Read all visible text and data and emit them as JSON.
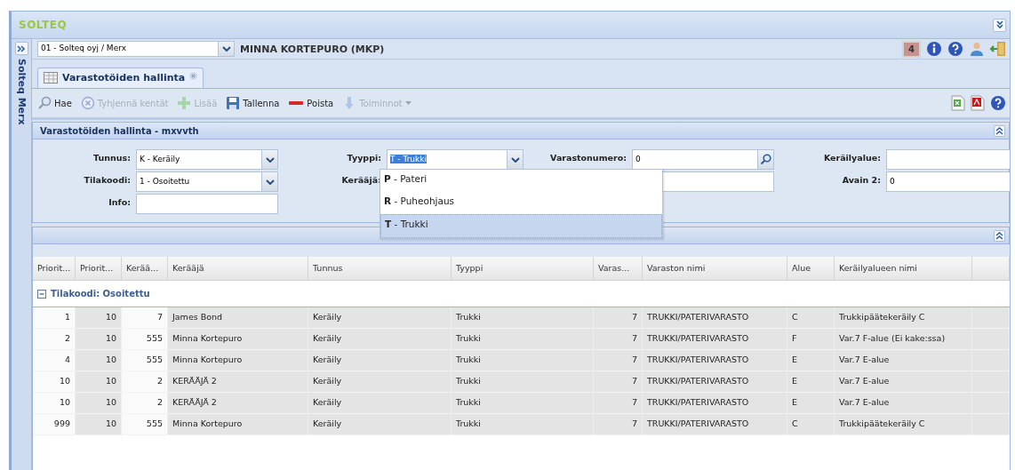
{
  "app": {
    "logo": "SOLTEQ"
  },
  "sidebar": {
    "title": "Solteq Merx",
    "expanded": false
  },
  "topbar": {
    "company": "01 - Solteq oyj / Merx",
    "user": "MINNA KORTEPURO (MKP)",
    "badge": "4"
  },
  "tabs": [
    {
      "label": "Varastotöiden hallinta",
      "selected": true
    }
  ],
  "toolbar": [
    {
      "kind": "search",
      "label": "Hae",
      "disabled": false
    },
    {
      "kind": "clear",
      "label": "Tyhjennä kentät",
      "disabled": true
    },
    {
      "kind": "add",
      "label": "Lisää",
      "disabled": true
    },
    {
      "kind": "save",
      "label": "Tallenna",
      "disabled": false
    },
    {
      "kind": "delete",
      "label": "Poista",
      "disabled": false
    },
    {
      "kind": "actions",
      "label": "Toiminnot",
      "disabled": true
    }
  ],
  "form": {
    "title": "Varastotöiden hallinta - mxvvth",
    "expanded": true,
    "fields": [
      {
        "kind": "combo",
        "label": "Tunnus:",
        "value": "K - Keräily"
      },
      {
        "kind": "combo",
        "label": "Tyyppi:",
        "value": "T - Trukki",
        "highlighted": true
      },
      {
        "kind": "search",
        "label": "Varastonumero:",
        "value": "0"
      },
      {
        "kind": "text",
        "label": "Keräilyalue:"
      },
      {
        "kind": "combo",
        "label": "Tilakoodi:",
        "value": "1 - Osoitettu"
      },
      {
        "kind": "wide",
        "label": "Kerääjä:"
      },
      {
        "kind": "text",
        "label": "Avain 2:",
        "value": "0"
      },
      {
        "kind": "text",
        "label": "Info:"
      }
    ]
  },
  "dropdown": {
    "options": [
      {
        "label": "**P** - Pateri",
        "selected": false
      },
      {
        "label": "**R** - Puheohjaus",
        "selected": false
      },
      {
        "label": "**T** - Trukki",
        "selected": true
      }
    ]
  },
  "results": {
    "expanded": true
  },
  "table": {
    "columns": [
      {
        "label": "Priorit...",
        "kind": "number"
      },
      {
        "label": "Priorit...",
        "kind": "number"
      },
      {
        "label": "Kerää...",
        "kind": "number"
      },
      {
        "label": "Kerääjä",
        "kind": "text"
      },
      {
        "label": "Tunnus",
        "kind": "text"
      },
      {
        "label": "Tyyppi",
        "kind": "text"
      },
      {
        "label": "Varas...",
        "kind": "number"
      },
      {
        "label": "Varaston nimi",
        "kind": "text"
      },
      {
        "label": "Alue",
        "kind": "text"
      },
      {
        "label": "Keräilyalueen nimi",
        "kind": "text"
      }
    ],
    "group": {
      "label": "Tilakoodi: Osoitettu",
      "expanded": true
    },
    "rows": [
      [
        "1",
        "10",
        "7",
        "James Bond",
        "Keräily",
        "Trukki",
        "7",
        "TRUKKI/PATERIVARASTO",
        "C",
        "Trukkipäätekeräily C"
      ],
      [
        "2",
        "10",
        "555",
        "Minna Kortepuro",
        "Keräily",
        "Trukki",
        "7",
        "TRUKKI/PATERIVARASTO",
        "F",
        "Var.7 F-alue (Ei kake:ssa)"
      ],
      [
        "4",
        "10",
        "555",
        "Minna Kortepuro",
        "Keräily",
        "Trukki",
        "7",
        "TRUKKI/PATERIVARASTO",
        "E",
        "Var.7 E-alue"
      ],
      [
        "10",
        "10",
        "2",
        "KERÄÄJÄ 2",
        "Keräily",
        "Trukki",
        "7",
        "TRUKKI/PATERIVARASTO",
        "E",
        "Var.7 E-alue"
      ],
      [
        "10",
        "10",
        "2",
        "KERÄÄJÄ 2",
        "Keräily",
        "Trukki",
        "7",
        "TRUKKI/PATERIVARASTO",
        "E",
        "Var.7 E-alue"
      ],
      [
        "999",
        "10",
        "555",
        "Minna Kortepuro",
        "Keräily",
        "Trukki",
        "7",
        "TRUKKI/PATERIVARASTO",
        "C",
        "Trukkipäätekeräily C"
      ]
    ]
  }
}
